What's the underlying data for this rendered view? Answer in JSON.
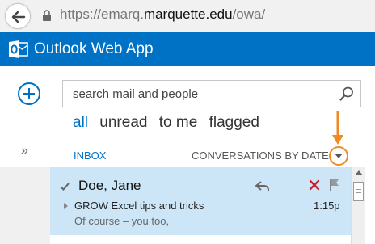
{
  "browser": {
    "url_prefix": "https://emarq.",
    "url_host": "marquette.edu",
    "url_suffix": "/owa/"
  },
  "app": {
    "title": "Outlook Web App"
  },
  "search": {
    "placeholder": "search mail and people"
  },
  "filters": [
    "all",
    "unread",
    "to me",
    "flagged"
  ],
  "folder": {
    "name": "INBOX",
    "arrange_by": "CONVERSATIONS BY DATE"
  },
  "messages": [
    {
      "sender": "Doe, Jane",
      "subject": "GROW Excel tips and tricks",
      "preview": "Of course – you too,",
      "time": "1:15p"
    }
  ],
  "icons": {
    "back": "back-arrow-icon",
    "lock": "lock-icon",
    "new": "new-mail-icon",
    "expand": "double-chevron-icon",
    "search": "search-icon",
    "reply": "reply-icon",
    "delete": "delete-icon",
    "flag": "flag-icon"
  },
  "colors": {
    "brand": "#0072c6",
    "selected_row": "#cde6f7",
    "annotation": "#f08a24",
    "delete": "#c8202f"
  }
}
